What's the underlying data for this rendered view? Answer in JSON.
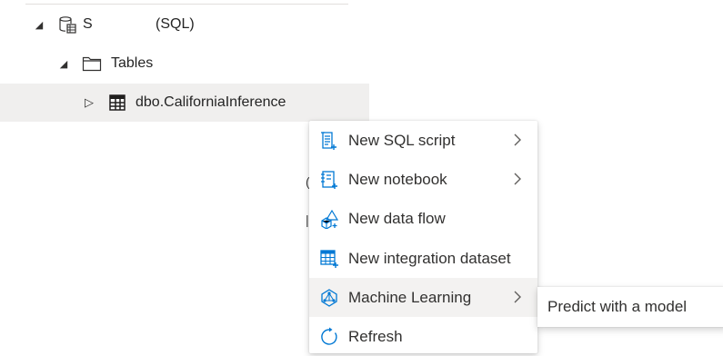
{
  "tree": {
    "database": {
      "name": "S",
      "suffix": "(SQL)"
    },
    "folder": {
      "label": "Tables"
    },
    "table": {
      "label": "dbo.CaliforniaInference"
    }
  },
  "context_menu": {
    "items": [
      {
        "label": "New SQL script",
        "icon": "sql-script-icon",
        "has_submenu": true
      },
      {
        "label": "New notebook",
        "icon": "notebook-icon",
        "has_submenu": true
      },
      {
        "label": "New data flow",
        "icon": "data-flow-icon",
        "has_submenu": false
      },
      {
        "label": "New integration dataset",
        "icon": "integration-dataset-icon",
        "has_submenu": false
      },
      {
        "label": "Machine Learning",
        "icon": "machine-learning-icon",
        "has_submenu": true,
        "active": true
      },
      {
        "label": "Refresh",
        "icon": "refresh-icon",
        "has_submenu": false
      }
    ]
  },
  "submenu": {
    "items": [
      {
        "label": "Predict with a model"
      }
    ]
  },
  "colors": {
    "accent": "#0078d4",
    "selected_row": "#f0efee",
    "hover": "#f3f2f1"
  }
}
